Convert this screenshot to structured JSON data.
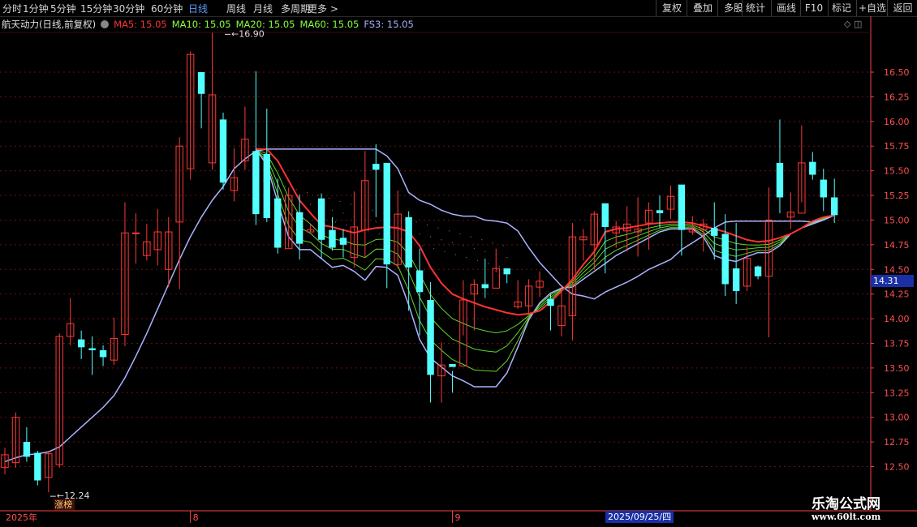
{
  "toolbar": {
    "periods": [
      "分时",
      "1分钟",
      "5分钟",
      "15分钟",
      "30分钟",
      "60分钟",
      "日线",
      "周线",
      "月线",
      "多周期",
      "更多"
    ],
    "active": "日线",
    "right_buttons": [
      "复权",
      "叠加",
      "多股",
      "统计",
      "画线",
      "F10",
      "标记",
      "+自选",
      "返回"
    ]
  },
  "legend": {
    "stock": "航天动力(日线,前复权)",
    "ma5": "MA5: 15.05",
    "ma10": "MA10: 15.05",
    "ma20": "MA20: 15.05",
    "ma60": "MA60: 15.05",
    "fs3": "FS3: 15.05"
  },
  "colors": {
    "up": "#ff3838",
    "down": "#54ffff",
    "ma5": "#ff3333",
    "ma10": "#8cff3c",
    "fs3": "#aab3ff",
    "grid": "#6b1010",
    "axis": "#ff4040"
  },
  "price_tag": "14.31",
  "date_tag": "2025/09/25/四",
  "watermark": {
    "title": "乐淘公式网",
    "url": "www.60lt.com"
  },
  "chart_data": {
    "type": "candlestick",
    "ylim": [
      12.35,
      16.95
    ],
    "y_ticks": [
      12.5,
      12.75,
      13.0,
      13.25,
      13.5,
      13.75,
      14.0,
      14.25,
      14.5,
      14.75,
      15.0,
      15.25,
      15.5,
      15.75,
      16.0,
      16.25,
      16.5
    ],
    "y_tick_labels": [
      "12.50",
      "12.75",
      "13.00",
      "13.25",
      "13.50",
      "13.75",
      "14.00",
      "14.25",
      "14.50",
      "14.75",
      "15.00",
      "15.25",
      "15.50",
      "15.75",
      "16.00",
      "16.25",
      "16.50"
    ],
    "x_labels": [
      {
        "idx": 0,
        "text": "2025年"
      },
      {
        "idx": 17,
        "text": "8"
      },
      {
        "idx": 41,
        "text": "9"
      }
    ],
    "annotations": [
      {
        "idx": 20,
        "price": 16.9,
        "text": "16.90"
      },
      {
        "idx": 4,
        "price": 12.24,
        "text": "12.24"
      }
    ],
    "event_label": {
      "idx": 5,
      "text": "涨榜"
    },
    "candles": [
      [
        12.49,
        12.62,
        12.69,
        12.42
      ],
      [
        12.54,
        13.0,
        13.05,
        12.49
      ],
      [
        12.75,
        12.6,
        12.9,
        12.55
      ],
      [
        12.64,
        12.36,
        12.66,
        12.31
      ],
      [
        12.39,
        12.63,
        12.66,
        12.24
      ],
      [
        12.52,
        13.82,
        13.85,
        12.49
      ],
      [
        13.82,
        13.95,
        14.21,
        13.73
      ],
      [
        13.79,
        13.71,
        13.88,
        13.59
      ],
      [
        13.7,
        13.68,
        13.82,
        13.43
      ],
      [
        13.68,
        13.61,
        13.73,
        13.52
      ],
      [
        13.58,
        13.8,
        14.01,
        13.53
      ],
      [
        13.84,
        14.87,
        15.18,
        13.72
      ],
      [
        14.87,
        14.87,
        15.07,
        14.56
      ],
      [
        14.64,
        14.78,
        14.96,
        14.59
      ],
      [
        14.7,
        14.88,
        15.11,
        14.54
      ],
      [
        14.5,
        14.88,
        15.03,
        14.32
      ],
      [
        14.98,
        15.75,
        15.84,
        14.3
      ],
      [
        15.52,
        16.68,
        16.71,
        15.41
      ],
      [
        16.5,
        16.28,
        16.49,
        15.93
      ],
      [
        15.58,
        16.27,
        16.9,
        15.51
      ],
      [
        16.02,
        15.38,
        16.09,
        15.31
      ],
      [
        15.3,
        15.43,
        15.73,
        15.19
      ],
      [
        15.6,
        15.82,
        16.15,
        15.51
      ],
      [
        15.7,
        15.06,
        16.51,
        14.95
      ],
      [
        15.67,
        15.02,
        16.13,
        14.98
      ],
      [
        15.22,
        14.72,
        15.42,
        14.66
      ],
      [
        14.71,
        15.25,
        15.33,
        14.72
      ],
      [
        15.08,
        14.76,
        15.26,
        14.6
      ],
      [
        14.88,
        14.9,
        14.96,
        14.88
      ],
      [
        15.22,
        14.8,
        15.27,
        14.61
      ],
      [
        14.9,
        14.72,
        15.03,
        14.69
      ],
      [
        14.82,
        14.75,
        14.91,
        14.62
      ],
      [
        14.62,
        14.93,
        15.29,
        14.52
      ],
      [
        14.9,
        15.4,
        15.7,
        14.62
      ],
      [
        15.57,
        15.51,
        15.77,
        15.03
      ],
      [
        15.58,
        14.55,
        15.4,
        14.31
      ],
      [
        14.55,
        15.06,
        15.3,
        14.51
      ],
      [
        15.03,
        14.52,
        15.09,
        14.08
      ],
      [
        14.49,
        14.27,
        14.71,
        13.83
      ],
      [
        14.19,
        13.43,
        14.37,
        13.15
      ],
      [
        13.42,
        13.53,
        13.76,
        13.15
      ],
      [
        13.54,
        13.51,
        13.47,
        13.25
      ],
      [
        13.52,
        14.19,
        14.39,
        13.83
      ],
      [
        14.25,
        14.35,
        14.4,
        13.88
      ],
      [
        14.35,
        14.31,
        14.61,
        14.21
      ],
      [
        14.31,
        14.51,
        14.71,
        14.47
      ],
      [
        14.51,
        14.45,
        14.5,
        14.36
      ],
      [
        14.12,
        14.17,
        14.39,
        14.1
      ],
      [
        14.13,
        14.33,
        14.4,
        14.04
      ],
      [
        14.32,
        14.38,
        14.48,
        14.22
      ],
      [
        14.2,
        14.13,
        14.25,
        13.88
      ],
      [
        13.93,
        14.13,
        14.33,
        13.82
      ],
      [
        14.03,
        14.83,
        14.97,
        13.78
      ],
      [
        14.8,
        14.83,
        14.91,
        14.59
      ],
      [
        14.75,
        15.06,
        15.09,
        14.5
      ],
      [
        15.17,
        14.93,
        15.17,
        14.46
      ],
      [
        14.87,
        14.93,
        14.99,
        14.72
      ],
      [
        14.89,
        14.96,
        15.14,
        14.68
      ],
      [
        14.88,
        14.91,
        15.23,
        14.63
      ],
      [
        14.97,
        15.1,
        15.18,
        14.7
      ],
      [
        15.1,
        15.07,
        15.25,
        14.92
      ],
      [
        15.11,
        15.24,
        15.35,
        15.01
      ],
      [
        15.36,
        14.9,
        15.35,
        14.64
      ],
      [
        14.88,
        14.92,
        15.04,
        14.85
      ],
      [
        14.9,
        14.96,
        15.01,
        14.68
      ],
      [
        14.92,
        14.84,
        15.18,
        14.6
      ],
      [
        14.86,
        14.35,
        15.06,
        14.23
      ],
      [
        14.51,
        14.28,
        14.97,
        14.15
      ],
      [
        14.33,
        14.61,
        14.73,
        14.28
      ],
      [
        14.53,
        14.43,
        14.54,
        14.4
      ],
      [
        14.43,
        15.0,
        15.33,
        13.81
      ],
      [
        15.58,
        15.23,
        16.02,
        15.07
      ],
      [
        15.03,
        15.08,
        15.28,
        14.91
      ],
      [
        15.07,
        15.58,
        15.96,
        15.18
      ],
      [
        15.59,
        15.46,
        15.69,
        15.41
      ],
      [
        15.41,
        15.23,
        15.52,
        15.09
      ],
      [
        15.23,
        15.05,
        15.42,
        14.97
      ]
    ],
    "ma5": [
      null,
      null,
      null,
      null,
      null,
      null,
      null,
      null,
      null,
      null,
      null,
      null,
      null,
      null,
      null,
      null,
      null,
      null,
      null,
      null,
      null,
      null,
      null,
      15.72,
      15.72,
      15.6,
      15.4,
      15.2,
      15.07,
      14.95,
      14.93,
      14.9,
      14.87,
      14.9,
      14.92,
      14.93,
      14.92,
      14.88,
      14.74,
      14.52,
      14.36,
      14.25,
      14.2,
      14.16,
      14.12,
      14.09,
      14.06,
      14.04,
      14.05,
      14.08,
      14.17,
      14.28,
      14.4,
      14.55,
      14.68,
      14.88,
      14.91,
      14.92,
      14.94,
      14.96,
      14.97,
      14.98,
      14.98,
      14.97,
      14.94,
      14.91,
      14.88,
      14.84,
      14.8,
      14.78,
      14.79,
      14.82,
      14.86,
      14.92,
      14.99,
      15.03,
      15.05
    ],
    "fs3": [
      12.55,
      12.59,
      12.62,
      12.63,
      12.65,
      12.7,
      12.8,
      12.9,
      13.0,
      13.1,
      13.22,
      13.4,
      13.62,
      13.85,
      14.1,
      14.35,
      14.6,
      14.83,
      15.03,
      15.2,
      15.34,
      15.52,
      15.62,
      15.7,
      15.72,
      15.72,
      15.72,
      15.72,
      15.72,
      15.72,
      15.72,
      15.72,
      15.72,
      15.72,
      15.72,
      15.65,
      15.52,
      15.28,
      15.2,
      15.16,
      15.1,
      15.06,
      15.04,
      15.04,
      15.0,
      14.99,
      14.97,
      14.89,
      14.72,
      14.57,
      14.45,
      14.33,
      14.25,
      14.23,
      14.2,
      14.27,
      14.32,
      14.37,
      14.43,
      14.5,
      14.55,
      14.6,
      14.7,
      14.77,
      14.84,
      14.92,
      14.98,
      14.99,
      14.99,
      14.99,
      14.99,
      14.99,
      14.99,
      14.99,
      14.98,
      15.0,
      15.05
    ],
    "fs3_lower": [
      null,
      null,
      null,
      null,
      null,
      null,
      null,
      null,
      null,
      null,
      null,
      null,
      null,
      null,
      null,
      null,
      null,
      null,
      null,
      null,
      null,
      null,
      null,
      15.72,
      15.56,
      15.18,
      14.83,
      14.7,
      14.7,
      14.61,
      14.52,
      14.54,
      14.48,
      14.39,
      14.53,
      14.52,
      14.44,
      14.14,
      13.79,
      13.6,
      13.51,
      13.42,
      13.37,
      13.31,
      13.31,
      13.31,
      13.45,
      13.71,
      13.99,
      14.16,
      14.26,
      14.31,
      14.32,
      14.4,
      14.48,
      14.56,
      14.64,
      14.7,
      14.76,
      14.82,
      14.88,
      14.91,
      14.91,
      14.91,
      14.83,
      14.64,
      14.6,
      14.58,
      14.63,
      14.67,
      14.67,
      14.74,
      14.86,
      14.92,
      14.96,
      15.0,
      15.05
    ]
  }
}
